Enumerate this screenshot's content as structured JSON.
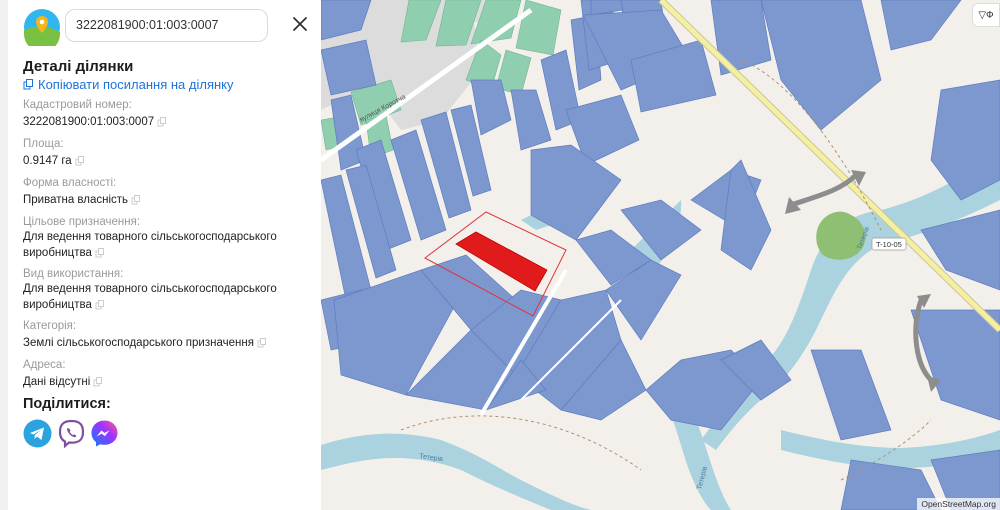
{
  "search": {
    "value": "3222081900:01:003:0007"
  },
  "details": {
    "title": "Деталі ділянки",
    "copy_link": "Копіювати посилання на ділянку",
    "fields": [
      {
        "label": "Кадастровий номер:",
        "value": "3222081900:01:003:0007"
      },
      {
        "label": "Площа:",
        "value": "0.9147 га"
      },
      {
        "label": "Форма власності:",
        "value": "Приватна власність"
      },
      {
        "label": "Цільове призначення:",
        "value": "Для ведення товарного сільськогосподарського виробництва"
      },
      {
        "label": "Вид використання:",
        "value": "Для ведення товарного сільськогосподарського виробництва"
      },
      {
        "label": "Категорія:",
        "value": "Землі сільськогосподарського призначення"
      },
      {
        "label": "Адреса:",
        "value": "Дані відсутні"
      }
    ]
  },
  "share": {
    "title": "Поділитися:",
    "icons": [
      "telegram-icon",
      "viber-icon",
      "messenger-icon"
    ]
  },
  "map": {
    "road_label": "T-10-05",
    "street_label": "вулиця Коротча",
    "river_labels": [
      "Тетерів",
      "Тетерів",
      "Тетерів"
    ],
    "filter_label": "Ф",
    "attribution": "OpenStreetMap.org",
    "colors": {
      "background": "#f3f0ec",
      "parcel": "#7d97cf",
      "parcel_border": "#5f7dbf",
      "selected_parcel": "#e11b1b",
      "selection_outline": "#e0353a",
      "water": "#aad3df",
      "green_parcel": "#8fcfb0",
      "road_yellow": "#f5f0a0",
      "bridge": "#8d8d8d",
      "forest": "#8fbf72"
    }
  }
}
